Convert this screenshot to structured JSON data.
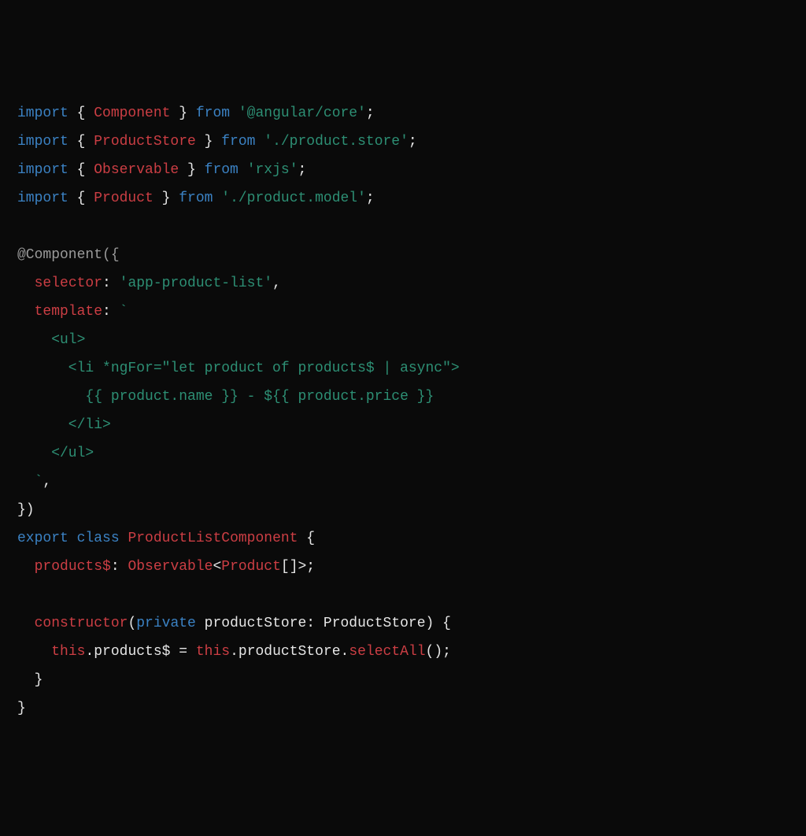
{
  "code": {
    "lines": [
      [
        {
          "t": "import",
          "c": "kw"
        },
        {
          "t": " { ",
          "c": "pun"
        },
        {
          "t": "Component",
          "c": "name"
        },
        {
          "t": " } ",
          "c": "pun"
        },
        {
          "t": "from",
          "c": "kw"
        },
        {
          "t": " ",
          "c": "pun"
        },
        {
          "t": "'@angular/core'",
          "c": "str"
        },
        {
          "t": ";",
          "c": "pun"
        }
      ],
      [
        {
          "t": "import",
          "c": "kw"
        },
        {
          "t": " { ",
          "c": "pun"
        },
        {
          "t": "ProductStore",
          "c": "name"
        },
        {
          "t": " } ",
          "c": "pun"
        },
        {
          "t": "from",
          "c": "kw"
        },
        {
          "t": " ",
          "c": "pun"
        },
        {
          "t": "'./product.store'",
          "c": "str"
        },
        {
          "t": ";",
          "c": "pun"
        }
      ],
      [
        {
          "t": "import",
          "c": "kw"
        },
        {
          "t": " { ",
          "c": "pun"
        },
        {
          "t": "Observable",
          "c": "name"
        },
        {
          "t": " } ",
          "c": "pun"
        },
        {
          "t": "from",
          "c": "kw"
        },
        {
          "t": " ",
          "c": "pun"
        },
        {
          "t": "'rxjs'",
          "c": "str"
        },
        {
          "t": ";",
          "c": "pun"
        }
      ],
      [
        {
          "t": "import",
          "c": "kw"
        },
        {
          "t": " { ",
          "c": "pun"
        },
        {
          "t": "Product",
          "c": "name"
        },
        {
          "t": " } ",
          "c": "pun"
        },
        {
          "t": "from",
          "c": "kw"
        },
        {
          "t": " ",
          "c": "pun"
        },
        {
          "t": "'./product.model'",
          "c": "str"
        },
        {
          "t": ";",
          "c": "pun"
        }
      ],
      [],
      [
        {
          "t": "@Component",
          "c": "deco"
        },
        {
          "t": "({",
          "c": "deco"
        }
      ],
      [
        {
          "t": "  ",
          "c": "pun"
        },
        {
          "t": "selector",
          "c": "name"
        },
        {
          "t": ": ",
          "c": "pun"
        },
        {
          "t": "'app-product-list'",
          "c": "str"
        },
        {
          "t": ",",
          "c": "pun"
        }
      ],
      [
        {
          "t": "  ",
          "c": "pun"
        },
        {
          "t": "template",
          "c": "name"
        },
        {
          "t": ": ",
          "c": "pun"
        },
        {
          "t": "`",
          "c": "str"
        }
      ],
      [
        {
          "t": "    <ul>",
          "c": "str"
        }
      ],
      [
        {
          "t": "      <li *ngFor=\"let product of products$ | async\">",
          "c": "str"
        }
      ],
      [
        {
          "t": "        {{ product.name }} - ${{ product.price }}",
          "c": "str"
        }
      ],
      [
        {
          "t": "      </li>",
          "c": "str"
        }
      ],
      [
        {
          "t": "    </ul>",
          "c": "str"
        }
      ],
      [
        {
          "t": "  `",
          "c": "str"
        },
        {
          "t": ",",
          "c": "pun"
        }
      ],
      [
        {
          "t": "})",
          "c": "pun"
        }
      ],
      [
        {
          "t": "export",
          "c": "kw"
        },
        {
          "t": " ",
          "c": "pun"
        },
        {
          "t": "class",
          "c": "kw"
        },
        {
          "t": " ",
          "c": "pun"
        },
        {
          "t": "ProductListComponent",
          "c": "name"
        },
        {
          "t": " {",
          "c": "pun"
        }
      ],
      [
        {
          "t": "  ",
          "c": "pun"
        },
        {
          "t": "products$",
          "c": "name"
        },
        {
          "t": ": ",
          "c": "pun"
        },
        {
          "t": "Observable",
          "c": "name"
        },
        {
          "t": "<",
          "c": "pun"
        },
        {
          "t": "Product",
          "c": "name"
        },
        {
          "t": "[]>;",
          "c": "pun"
        }
      ],
      [],
      [
        {
          "t": "  ",
          "c": "pun"
        },
        {
          "t": "constructor",
          "c": "name"
        },
        {
          "t": "(",
          "c": "pun"
        },
        {
          "t": "private",
          "c": "kw"
        },
        {
          "t": " productStore: ProductStore) {",
          "c": "id"
        }
      ],
      [
        {
          "t": "    ",
          "c": "pun"
        },
        {
          "t": "this",
          "c": "this"
        },
        {
          "t": ".products$ = ",
          "c": "id"
        },
        {
          "t": "this",
          "c": "this"
        },
        {
          "t": ".productStore.",
          "c": "id"
        },
        {
          "t": "selectAll",
          "c": "call"
        },
        {
          "t": "();",
          "c": "pun"
        }
      ],
      [
        {
          "t": "  }",
          "c": "pun"
        }
      ],
      [
        {
          "t": "}",
          "c": "pun"
        }
      ]
    ]
  }
}
